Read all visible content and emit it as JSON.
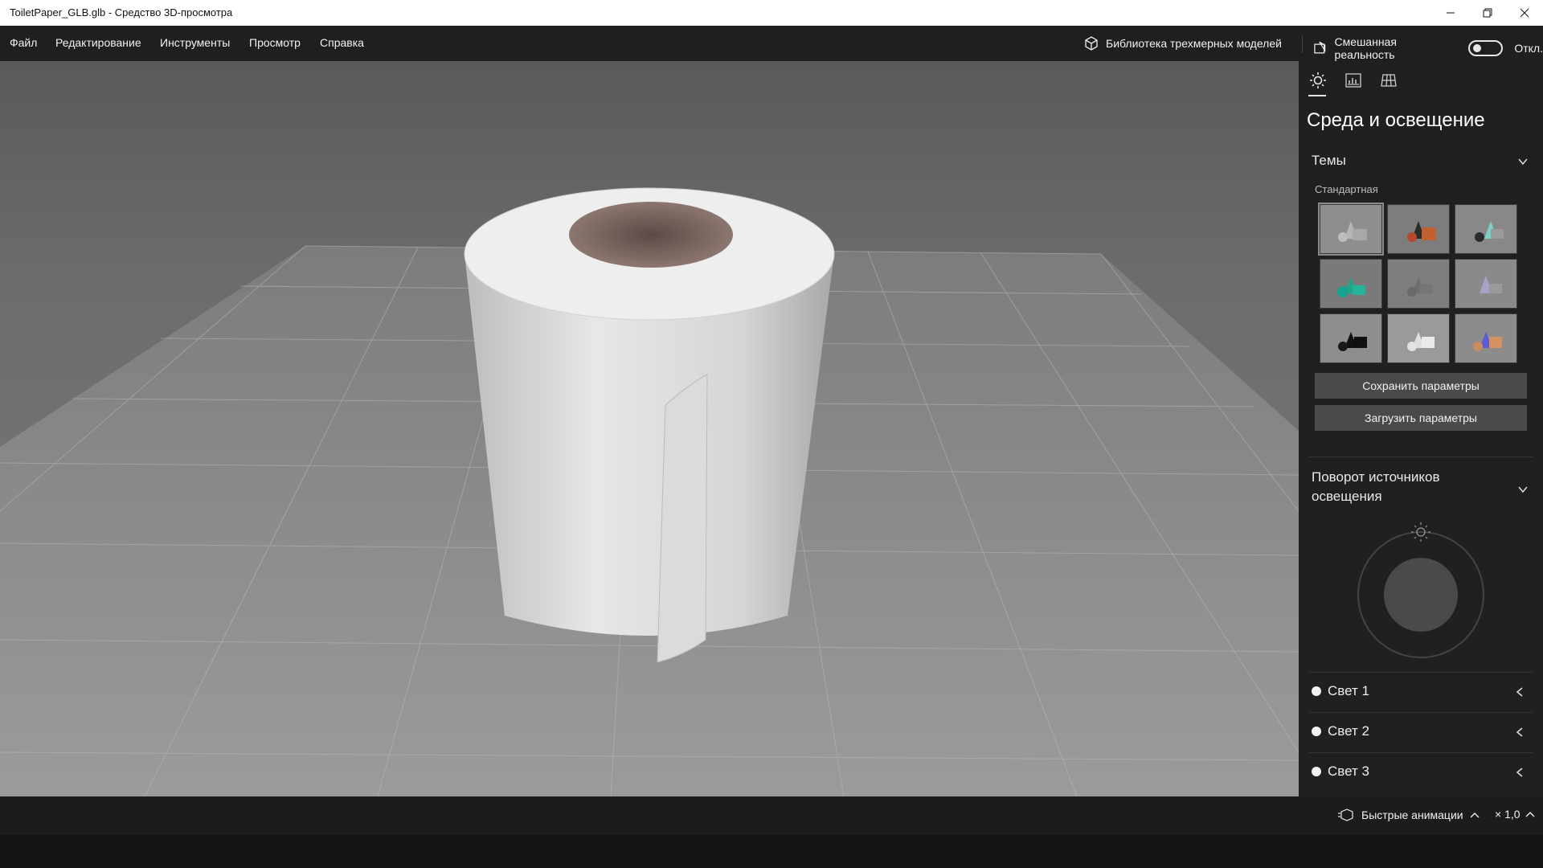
{
  "window": {
    "title": "ToiletPaper_GLB.glb - Средство 3D-просмотра",
    "minimize_icon": "minimize-icon",
    "restore_icon": "restore-icon",
    "close_icon": "close-icon"
  },
  "menu": {
    "items": [
      "Файл",
      "Редактирование",
      "Инструменты",
      "Просмотр",
      "Справка"
    ],
    "library_label": "Библиотека трехмерных моделей",
    "mixed_reality_label": "Смешанная реальность",
    "mixed_reality_state": "Откл."
  },
  "panel": {
    "tabs": [
      "environment-lighting-tab",
      "stats-tab",
      "grid-tab"
    ],
    "title": "Среда и освещение",
    "themes_header": "Темы",
    "themes_sub": "Стандартная",
    "save_button": "Сохранить параметры",
    "load_button": "Загрузить параметры",
    "rotation_header": "Поворот источников освещения",
    "lights": [
      "Свет 1",
      "Свет 2",
      "Свет 3"
    ]
  },
  "status": {
    "quick_animations": "Быстрые анимации",
    "speed": "× 1,0"
  },
  "colors": {
    "accent": "#e6e6e6",
    "panel_bg": "#202020",
    "menubar_bg": "#1f1f1f"
  }
}
